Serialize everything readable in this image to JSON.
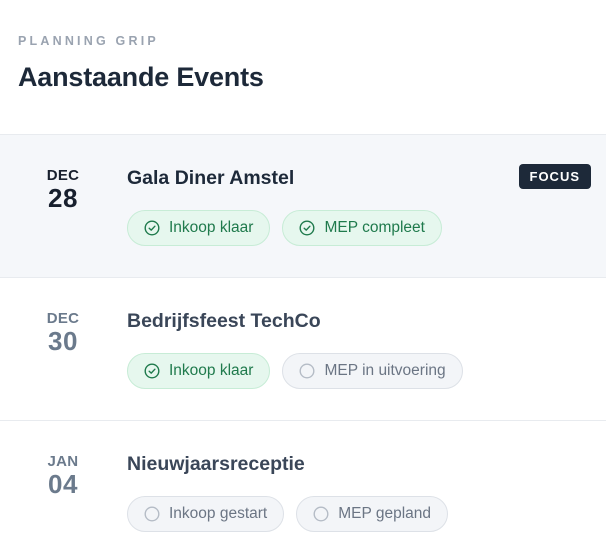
{
  "header": {
    "eyebrow": "PLANNING GRIP",
    "title": "Aanstaande Events"
  },
  "events": [
    {
      "month": "DEC",
      "day": "28",
      "title": "Gala Diner Amstel",
      "badge": "FOCUS",
      "chips": [
        {
          "label": "Inkoop klaar",
          "state": "done",
          "icon": "check-circle-icon"
        },
        {
          "label": "MEP compleet",
          "state": "done",
          "icon": "check-circle-icon"
        }
      ]
    },
    {
      "month": "DEC",
      "day": "30",
      "title": "Bedrijfsfeest TechCo",
      "chips": [
        {
          "label": "Inkoop klaar",
          "state": "done",
          "icon": "check-circle-icon"
        },
        {
          "label": "MEP in uitvoering",
          "state": "todo",
          "icon": "empty-circle-icon"
        }
      ]
    },
    {
      "month": "JAN",
      "day": "04",
      "title": "Nieuwjaarsreceptie",
      "chips": [
        {
          "label": "Inkoop gestart",
          "state": "todo",
          "icon": "empty-circle-icon"
        },
        {
          "label": "MEP gepland",
          "state": "todo",
          "icon": "empty-circle-icon"
        }
      ]
    }
  ],
  "colors": {
    "done_text": "#1f7a4c",
    "done_bg": "#e6f7ee",
    "todo_text": "#6b7584",
    "todo_bg": "#f3f5f8",
    "badge_bg": "#1d2939"
  }
}
